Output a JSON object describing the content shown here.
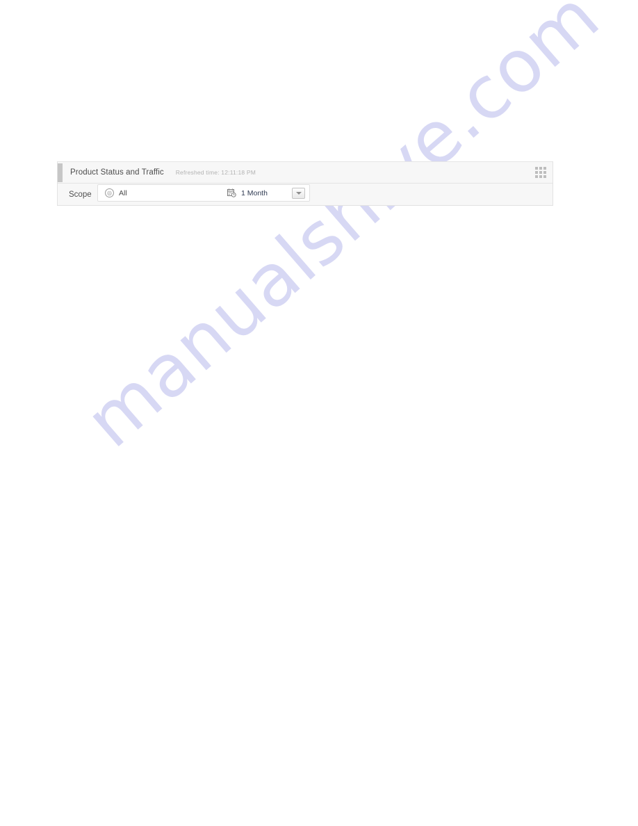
{
  "watermark": {
    "text": "manualshive.com",
    "color": "#c9caf0"
  },
  "panel": {
    "header": {
      "title": "Product Status and Traffic",
      "refreshed_time": "Refreshed time: 12:11:18 PM",
      "grid_icon": "grid-menu-icon"
    },
    "body": {
      "scope_label": "Scope",
      "scope_icon": "globe-circle-icon",
      "scope_value": "All",
      "calendar_icon": "calendar-clock-icon",
      "range_value": "1 Month",
      "dropdown_icon": "chevron-down-icon"
    }
  }
}
